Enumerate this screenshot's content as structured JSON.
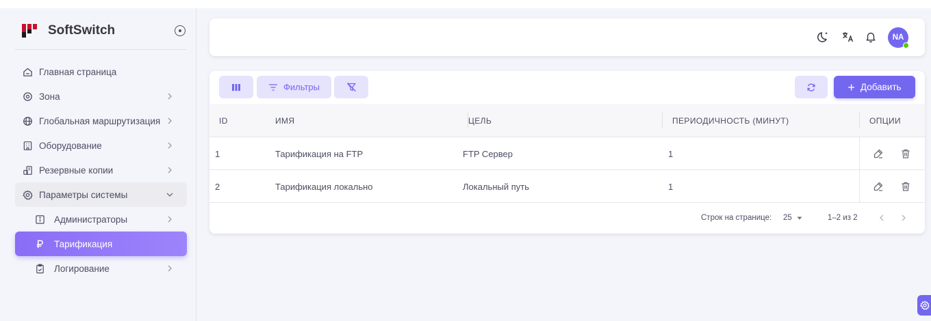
{
  "brand": {
    "name": "SoftSwitch"
  },
  "sidebar": {
    "items": [
      {
        "label": "Главная страница"
      },
      {
        "label": "Зона"
      },
      {
        "label": "Глобальная маршрутизация"
      },
      {
        "label": "Оборудование"
      },
      {
        "label": "Резервные копии"
      },
      {
        "label": "Параметры системы"
      },
      {
        "label": "Администраторы"
      },
      {
        "label": "Тарификация"
      },
      {
        "label": "Логирование"
      }
    ]
  },
  "topbar": {
    "avatar_initials": "NA"
  },
  "toolbar": {
    "filters_label": "Фильтры",
    "add_label": "Добавить"
  },
  "table": {
    "columns": [
      "ID",
      "ИМЯ",
      "ЦЕЛЬ",
      "ПЕРИОДИЧНОСТЬ (МИНУТ)",
      "ОПЦИИ"
    ],
    "rows": [
      {
        "id": "1",
        "name": "Тарификация на FTP",
        "target": "FTP Сервер",
        "period": "1"
      },
      {
        "id": "2",
        "name": "Тарификация локально",
        "target": "Локальный путь",
        "period": "1"
      }
    ]
  },
  "pagination": {
    "rows_per_page_label": "Строк на странице:",
    "rows_per_page_value": "25",
    "range_text": "1–2 из 2"
  },
  "colors": {
    "accent": "#7367f0",
    "accent_light": "#e6e3fc",
    "online": "#56ca00"
  }
}
